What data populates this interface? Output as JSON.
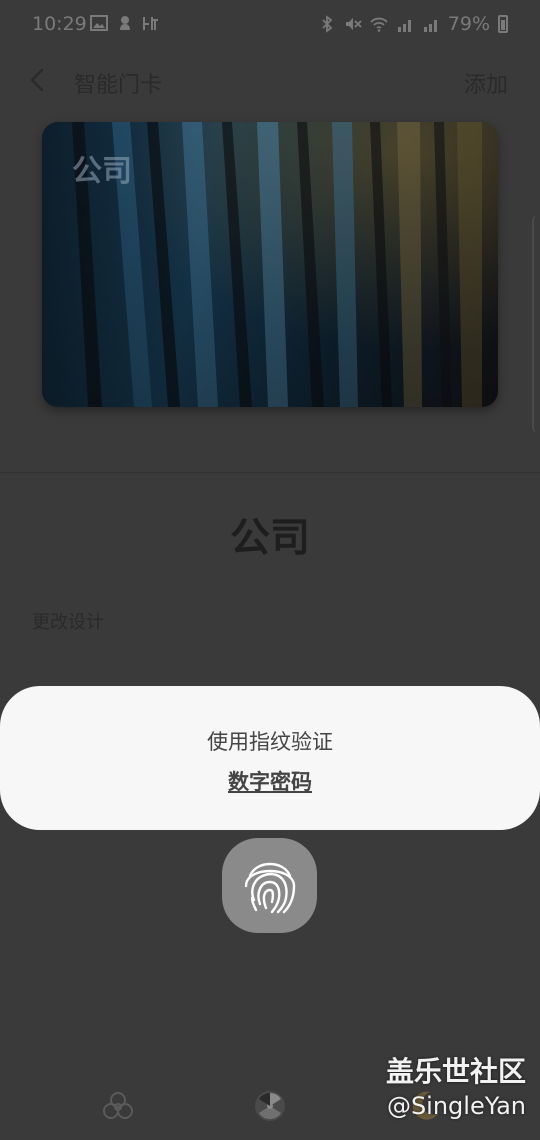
{
  "status_bar": {
    "time": "10:29",
    "left_icons": [
      "image-icon",
      "notification-icon",
      "ting-app-icon"
    ],
    "right_icons": [
      "bluetooth-icon",
      "mute-icon",
      "wifi-icon",
      "hd-icon",
      "signal-4g-icon",
      "signal-4g-icon"
    ],
    "battery": "79%"
  },
  "app_bar": {
    "title": "智能门卡",
    "add_label": "添加",
    "back_icon": "chevron-left-icon"
  },
  "card": {
    "name": "公司"
  },
  "detail": {
    "title": "公司",
    "change_design": "更改设计"
  },
  "auth_dialog": {
    "title": "使用指纹验证",
    "alt_link": "数字密码"
  },
  "fingerprint": {
    "icon": "fingerprint-icon"
  },
  "bottom_icons": [
    "biohazard-icon",
    "radiation-icon",
    "moon-icon"
  ],
  "watermark": {
    "title": "盖乐世社区",
    "handle": "@SingleYan"
  },
  "colors": {
    "dim_background": "#3a3a3a",
    "dialog_background": "#f7f7f7",
    "fingerprint_button": "#8a8a8a"
  }
}
